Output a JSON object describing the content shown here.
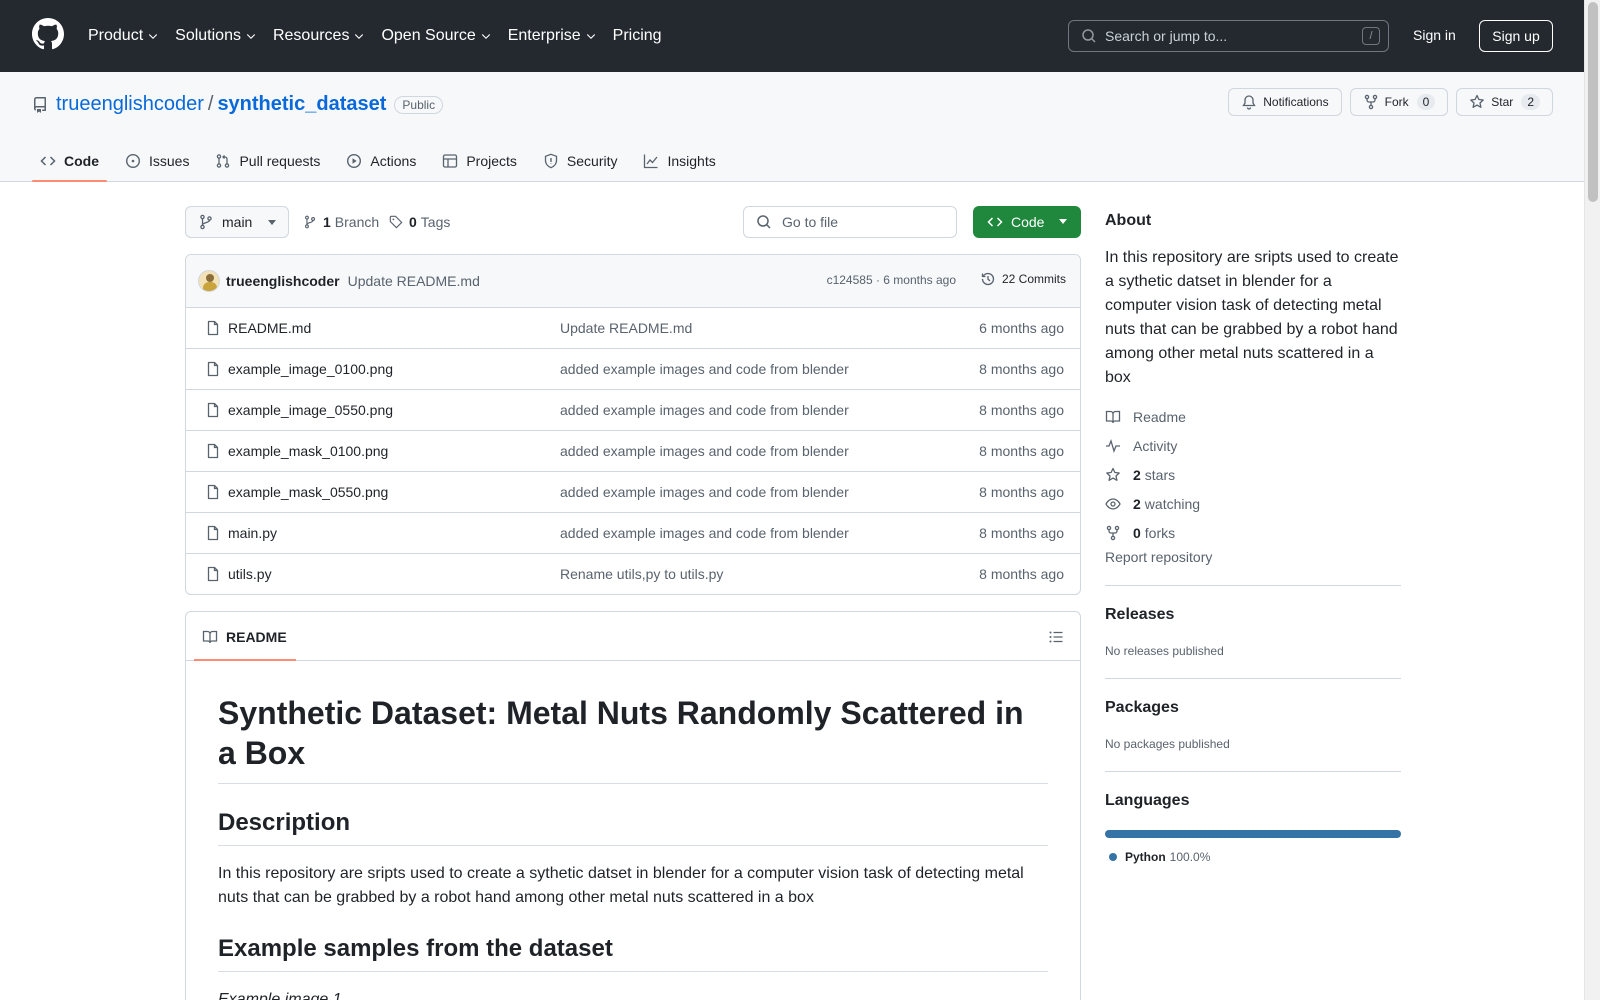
{
  "header": {
    "nav": [
      "Product",
      "Solutions",
      "Resources",
      "Open Source",
      "Enterprise",
      "Pricing"
    ],
    "search_placeholder": "Search or jump to...",
    "slash_key": "/",
    "sign_in": "Sign in",
    "sign_up": "Sign up"
  },
  "repo": {
    "owner": "trueenglishcoder",
    "separator": "/",
    "name": "synthetic_dataset",
    "visibility": "Public",
    "notifications_label": "Notifications",
    "fork_label": "Fork",
    "fork_count": "0",
    "star_label": "Star",
    "star_count": "2"
  },
  "repo_nav": {
    "code": "Code",
    "issues": "Issues",
    "pull_requests": "Pull requests",
    "actions": "Actions",
    "projects": "Projects",
    "security": "Security",
    "insights": "Insights"
  },
  "toolbar": {
    "branch": "main",
    "branch_count": "1",
    "branch_label": "Branch",
    "tag_count": "0",
    "tag_label": "Tags",
    "goto_placeholder": "Go to file",
    "code_button": "Code"
  },
  "latest_commit": {
    "author": "trueenglishcoder",
    "message": "Update README.md",
    "meta": "c124585 · 6 months ago",
    "commits": "22 Commits"
  },
  "files": [
    {
      "name": "README.md",
      "message": "Update README.md",
      "date": "6 months ago"
    },
    {
      "name": "example_image_0100.png",
      "message": "added example images and code from blender",
      "date": "8 months ago"
    },
    {
      "name": "example_image_0550.png",
      "message": "added example images and code from blender",
      "date": "8 months ago"
    },
    {
      "name": "example_mask_0100.png",
      "message": "added example images and code from blender",
      "date": "8 months ago"
    },
    {
      "name": "example_mask_0550.png",
      "message": "added example images and code from blender",
      "date": "8 months ago"
    },
    {
      "name": "main.py",
      "message": "added example images and code from blender",
      "date": "8 months ago"
    },
    {
      "name": "utils.py",
      "message": "Rename utils,py to utils.py",
      "date": "8 months ago"
    }
  ],
  "readme": {
    "tab": "README",
    "h1": "Synthetic Dataset: Metal Nuts Randomly Scattered in a Box",
    "h2_description": "Description",
    "description": "In this repository are sripts used to create a sythetic datset in blender for a computer vision task of detecting metal nuts that can be grabbed by a robot hand among other metal nuts scattered in a box",
    "h2_examples": "Example samples from the dataset",
    "example_caption": "Example image 1"
  },
  "sidebar": {
    "about_heading": "About",
    "about_text": "In this repository are sripts used to create a sythetic datset in blender for a computer vision task of detecting metal nuts that can be grabbed by a robot hand among other metal nuts scattered in a box",
    "readme": "Readme",
    "activity": "Activity",
    "stars_count": "2",
    "stars_label": "stars",
    "watching_count": "2",
    "watching_label": "watching",
    "forks_count": "0",
    "forks_label": "forks",
    "report": "Report repository",
    "releases_heading": "Releases",
    "releases_text": "No releases published",
    "packages_heading": "Packages",
    "packages_text": "No packages published",
    "languages_heading": "Languages",
    "language_name": "Python",
    "language_pct": "100.0%",
    "language_fraction": 1.0,
    "language_color": "#3572A5"
  },
  "colors": {
    "header_bg": "#24292f",
    "link": "#0969da",
    "code_button": "#1f883d",
    "tab_underline": "#fd8c73"
  }
}
